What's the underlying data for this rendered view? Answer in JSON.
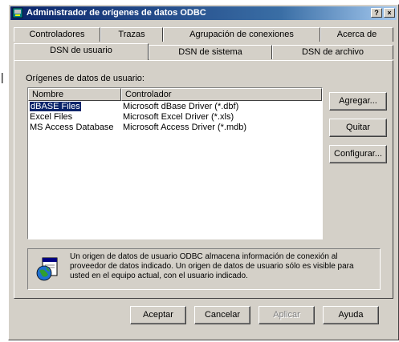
{
  "window": {
    "title": "Administrador de orígenes de datos ODBC",
    "help_button": "?",
    "close_button": "×"
  },
  "tabs_back": [
    "Controladores",
    "Trazas",
    "Agrupación de conexiones",
    "Acerca de"
  ],
  "tabs_front": [
    "DSN de usuario",
    "DSN de sistema",
    "DSN de archivo"
  ],
  "list_label": "Orígenes de datos de usuario:",
  "columns": [
    "Nombre",
    "Controlador"
  ],
  "rows": [
    {
      "name": "dBASE Files",
      "driver": "Microsoft dBase Driver (*.dbf)",
      "selected": true
    },
    {
      "name": "Excel Files",
      "driver": "Microsoft Excel Driver (*.xls)",
      "selected": false
    },
    {
      "name": "MS Access Database",
      "driver": "Microsoft Access Driver (*.mdb)",
      "selected": false
    }
  ],
  "side_buttons": {
    "add": "Agregar...",
    "remove": "Quitar",
    "configure": "Configurar..."
  },
  "info_text": "Un origen de datos de usuario ODBC almacena información de conexión al proveedor de datos indicado. Un origen de datos de usuario sólo es visible para usted en el equipo actual, con el usuario indicado.",
  "bottom_buttons": {
    "ok": "Aceptar",
    "cancel": "Cancelar",
    "apply": "Aplicar",
    "help": "Ayuda"
  }
}
